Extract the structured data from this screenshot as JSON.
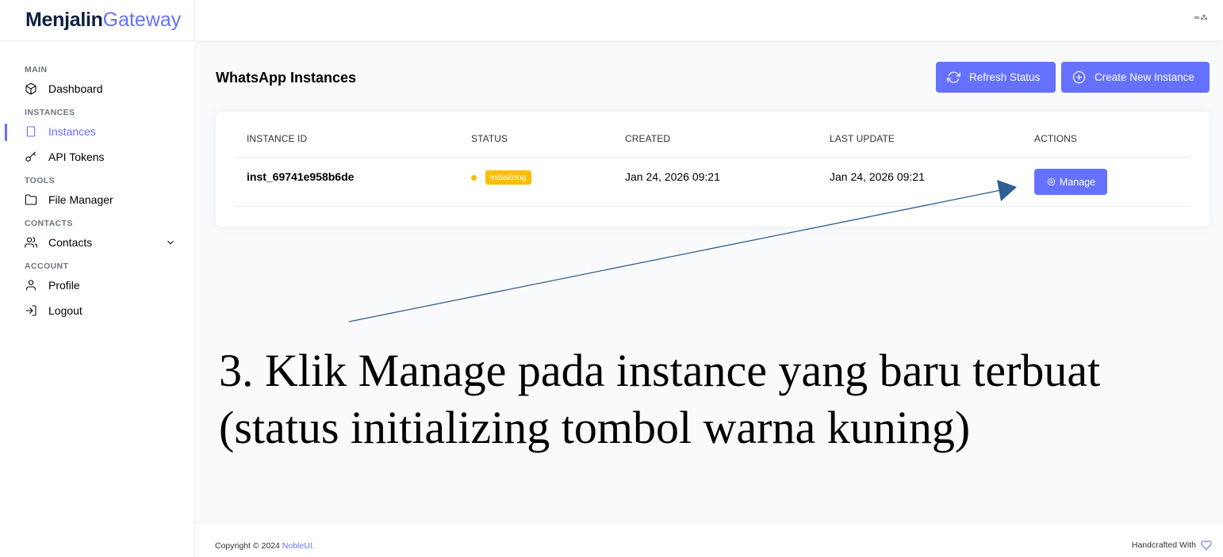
{
  "brand": {
    "part1": "Menjalin",
    "part2": "Gateway"
  },
  "topbar": {
    "flag_label": "═ ⁂"
  },
  "sidebar": {
    "sections": [
      {
        "label": "MAIN",
        "items": [
          {
            "label": "Dashboard",
            "icon": "box-icon"
          }
        ]
      },
      {
        "label": "INSTANCES",
        "items": [
          {
            "label": "Instances",
            "icon": "tablet-icon",
            "active": true
          },
          {
            "label": "API Tokens",
            "icon": "key-icon"
          }
        ]
      },
      {
        "label": "TOOLS",
        "items": [
          {
            "label": "File Manager",
            "icon": "folder-icon"
          }
        ]
      },
      {
        "label": "CONTACTS",
        "items": [
          {
            "label": "Contacts",
            "icon": "users-icon",
            "expandable": true
          }
        ]
      },
      {
        "label": "ACCOUNT",
        "items": [
          {
            "label": "Profile",
            "icon": "user-icon"
          },
          {
            "label": "Logout",
            "icon": "log-in-icon"
          }
        ]
      }
    ]
  },
  "page": {
    "title": "WhatsApp Instances",
    "refresh_label": "Refresh Status",
    "create_label": "Create New Instance"
  },
  "table": {
    "headers": [
      "INSTANCE ID",
      "STATUS",
      "CREATED",
      "LAST UPDATE",
      "ACTIONS"
    ],
    "rows": [
      {
        "id": "inst_69741e958b6de",
        "status": "initializing",
        "created": "Jan 24, 2026 09:21",
        "updated": "Jan 24, 2026 09:21",
        "action": "Manage"
      }
    ]
  },
  "annotation": {
    "line1": "3. Klik Manage pada instance yang baru terbuat",
    "line2": "(status initializing tombol warna kuning)"
  },
  "footer": {
    "copyright_prefix": "Copyright © 2024 ",
    "copyright_link": "NobleUI.",
    "handcrafted": "Handcrafted With"
  },
  "colors": {
    "accent": "#6571ff",
    "warning": "#fbbc06",
    "annotation_arrow": "#2f5f94"
  }
}
